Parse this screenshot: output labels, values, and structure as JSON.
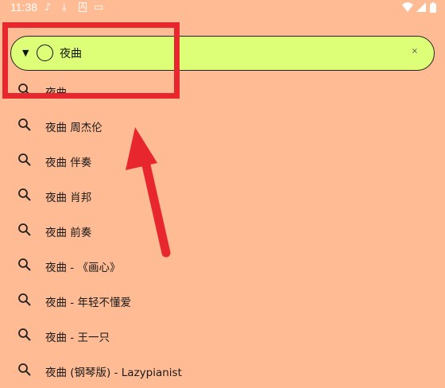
{
  "status_bar": {
    "time": "11:38",
    "left_icons": [
      "music-note-icon",
      "download-icon",
      "a-icon",
      "cast-icon"
    ],
    "right_icons": [
      "wifi-icon",
      "signal-icon",
      "battery-icon"
    ]
  },
  "search_bar": {
    "query": "夜曲",
    "dropdown_icon": "triangle-down-icon",
    "clear_icon": "x-icon",
    "background": "#ddff77"
  },
  "suggestions": [
    {
      "label": "夜曲"
    },
    {
      "label": "夜曲 周杰伦"
    },
    {
      "label": "夜曲 伴奏"
    },
    {
      "label": "夜曲 肖邦"
    },
    {
      "label": "夜曲 前奏"
    },
    {
      "label": "夜曲 - 《画心》"
    },
    {
      "label": "夜曲 - 年轻不懂爱"
    },
    {
      "label": "夜曲 - 王一只"
    },
    {
      "label": "夜曲 (钢琴版) - Lazypianist"
    }
  ],
  "annotation": {
    "box_color": "#e8262d",
    "arrow_color": "#e8262d"
  },
  "colors": {
    "background": "#ffbb94",
    "search_bar": "#ddff77"
  }
}
